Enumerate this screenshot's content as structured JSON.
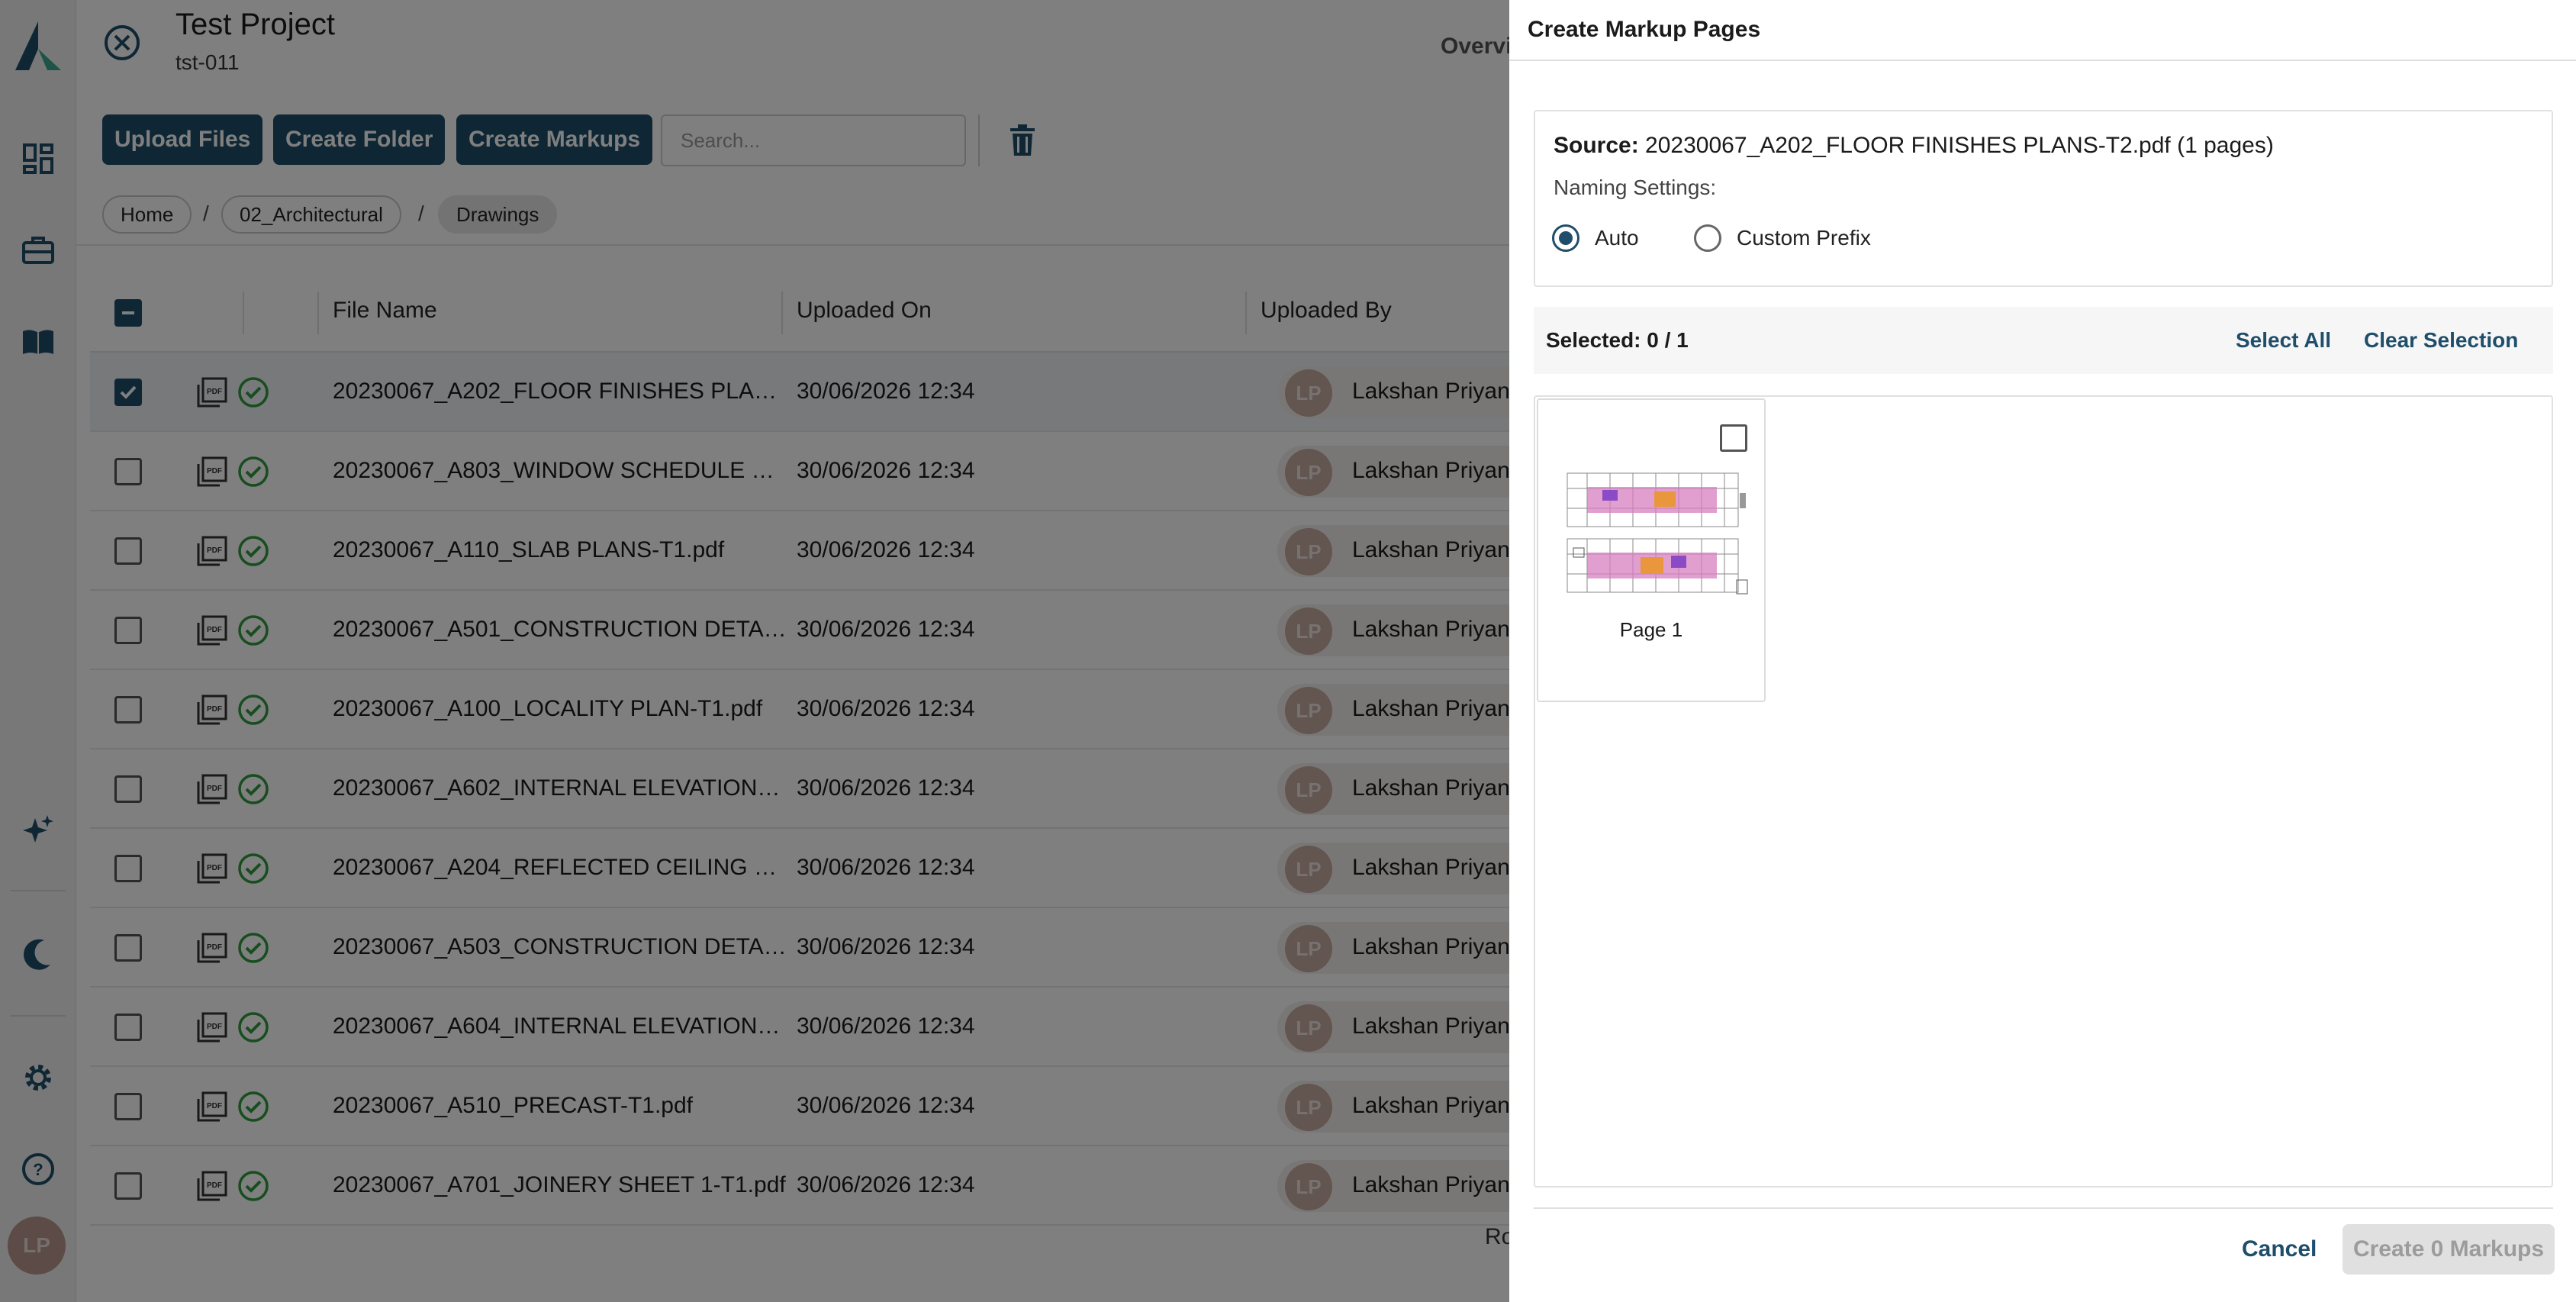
{
  "nav": {
    "icons": [
      "logo-icon",
      "dashboard-icon",
      "briefcase-icon",
      "book-icon",
      "sparkles-icon",
      "moon-icon",
      "gear-icon",
      "help-icon"
    ],
    "user_initials": "LP"
  },
  "header": {
    "title": "Test Project",
    "code": "tst-011",
    "overview_link": "Overvi"
  },
  "toolbar": {
    "upload_label": "Upload Files",
    "create_folder_label": "Create Folder",
    "create_markups_label": "Create Markups",
    "search_placeholder": "Search..."
  },
  "breadcrumb": [
    "Home",
    "02_Architectural",
    "Drawings"
  ],
  "breadcrumb_separator": "/",
  "table": {
    "columns": [
      "File Name",
      "Uploaded On",
      "Uploaded By"
    ],
    "rows": [
      {
        "name": "20230067_A202_FLOOR FINISHES PLA…",
        "date": "30/06/2026 12:34",
        "user": "Lakshan Priyank",
        "initials": "LP",
        "checked": true
      },
      {
        "name": "20230067_A803_WINDOW SCHEDULE …",
        "date": "30/06/2026 12:34",
        "user": "Lakshan Priyank",
        "initials": "LP",
        "checked": false
      },
      {
        "name": "20230067_A110_SLAB PLANS-T1.pdf",
        "date": "30/06/2026 12:34",
        "user": "Lakshan Priyank",
        "initials": "LP",
        "checked": false
      },
      {
        "name": "20230067_A501_CONSTRUCTION DETA…",
        "date": "30/06/2026 12:34",
        "user": "Lakshan Priyank",
        "initials": "LP",
        "checked": false
      },
      {
        "name": "20230067_A100_LOCALITY PLAN-T1.pdf",
        "date": "30/06/2026 12:34",
        "user": "Lakshan Priyank",
        "initials": "LP",
        "checked": false
      },
      {
        "name": "20230067_A602_INTERNAL ELEVATION…",
        "date": "30/06/2026 12:34",
        "user": "Lakshan Priyank",
        "initials": "LP",
        "checked": false
      },
      {
        "name": "20230067_A204_REFLECTED CEILING …",
        "date": "30/06/2026 12:34",
        "user": "Lakshan Priyank",
        "initials": "LP",
        "checked": false
      },
      {
        "name": "20230067_A503_CONSTRUCTION DETA…",
        "date": "30/06/2026 12:34",
        "user": "Lakshan Priyank",
        "initials": "LP",
        "checked": false
      },
      {
        "name": "20230067_A604_INTERNAL ELEVATION…",
        "date": "30/06/2026 12:34",
        "user": "Lakshan Priyank",
        "initials": "LP",
        "checked": false
      },
      {
        "name": "20230067_A510_PRECAST-T1.pdf",
        "date": "30/06/2026 12:34",
        "user": "Lakshan Priyank",
        "initials": "LP",
        "checked": false
      },
      {
        "name": "20230067_A701_JOINERY SHEET 1-T1.pdf",
        "date": "30/06/2026 12:34",
        "user": "Lakshan Priyank",
        "initials": "LP",
        "checked": false
      }
    ],
    "footer_label": "Ro"
  },
  "drawer": {
    "title": "Create Markup Pages",
    "source_label": "Source:",
    "source_value": "20230067_A202_FLOOR FINISHES PLANS-T2.pdf (1 pages)",
    "naming_label": "Naming Settings:",
    "naming_options": [
      "Auto",
      "Custom Prefix"
    ],
    "naming_selected": "Auto",
    "selected_text": "Selected: 0 / 1",
    "select_all_label": "Select All",
    "clear_selection_label": "Clear Selection",
    "pages": [
      {
        "label": "Page 1",
        "selected": false
      }
    ],
    "cancel_label": "Cancel",
    "create_label": "Create 0 Markups"
  },
  "colors": {
    "primary": "#1f4e6b",
    "success": "#2e9b3e",
    "overlay": "rgba(0,0,0,0.5)",
    "disabled_bg": "#e0e0e0",
    "disabled_text": "#9c9c9c"
  }
}
